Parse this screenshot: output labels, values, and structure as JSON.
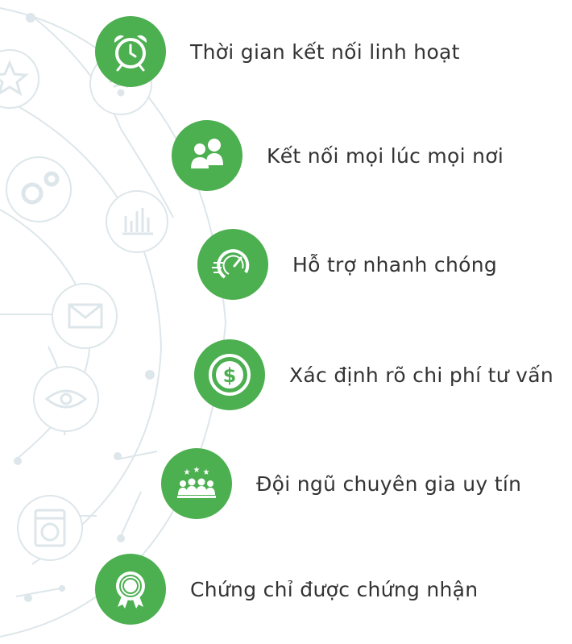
{
  "colors": {
    "accent": "#4caf50",
    "text": "#333333",
    "background_lines": "#dde6ea"
  },
  "features": [
    {
      "label": "Thời gian kết nối linh hoạt",
      "icon": "alarm-clock-icon"
    },
    {
      "label": "Kết nối mọi lúc mọi nơi",
      "icon": "users-icon"
    },
    {
      "label": "Hỗ trợ nhanh chóng",
      "icon": "speedometer-icon"
    },
    {
      "label": "Xác định rõ chi phí tư vấn",
      "icon": "dollar-coin-icon"
    },
    {
      "label": "Đội ngũ chuyên gia uy tín",
      "icon": "expert-team-icon"
    },
    {
      "label": "Chứng chỉ được chứng nhận",
      "icon": "certificate-badge-icon"
    }
  ],
  "background_icons": [
    "star-icon",
    "wifi-icon",
    "gears-icon",
    "bar-chart-icon",
    "envelope-icon",
    "eye-icon",
    "washing-machine-icon"
  ]
}
